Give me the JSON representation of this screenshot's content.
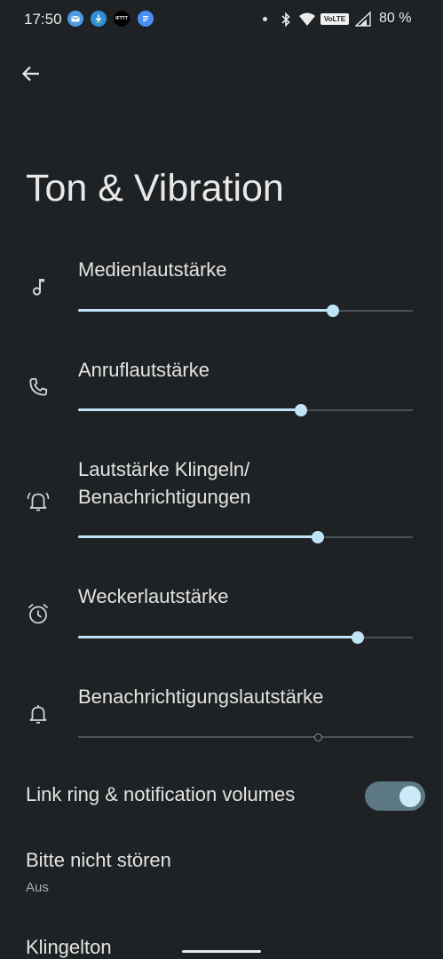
{
  "status_bar": {
    "time": "17:50",
    "notifications": [
      {
        "icon": "mail-icon",
        "color": "#4d9be3"
      },
      {
        "icon": "download-icon",
        "color": "#2f8fd8"
      },
      {
        "icon": "ifttt-icon",
        "label": "IFTTT",
        "color": "#000000"
      },
      {
        "icon": "docs-icon",
        "color": "#4a8ef5"
      }
    ],
    "volte": "VoLTE",
    "battery": "80 %"
  },
  "page": {
    "title": "Ton & Vibration"
  },
  "volumes": [
    {
      "icon": "music-note-icon",
      "label": "Medienlautstärke",
      "level": 0.76
    },
    {
      "icon": "phone-icon",
      "label": "Anruflautstärke",
      "level": 0.665
    },
    {
      "icon": "bell-ring-icon",
      "label_line1": "Lautstärke Klingeln/",
      "label_line2": "Benachrichtigungen",
      "level": 0.715
    },
    {
      "icon": "alarm-clock-icon",
      "label": "Weckerlautstärke",
      "level": 0.835
    },
    {
      "icon": "bell-icon",
      "label": "Benachrichtigungslautstärke",
      "level": 0.715,
      "enabled": false
    }
  ],
  "link_ring": {
    "label": "Link ring & notification volumes",
    "on": true
  },
  "dnd": {
    "title": "Bitte nicht stören",
    "subtitle": "Aus"
  },
  "ringtone": {
    "title": "Klingelton"
  },
  "colors": {
    "background": "#1f2224",
    "accent": "#bfe4f7",
    "toggle_track": "#5d7885"
  }
}
